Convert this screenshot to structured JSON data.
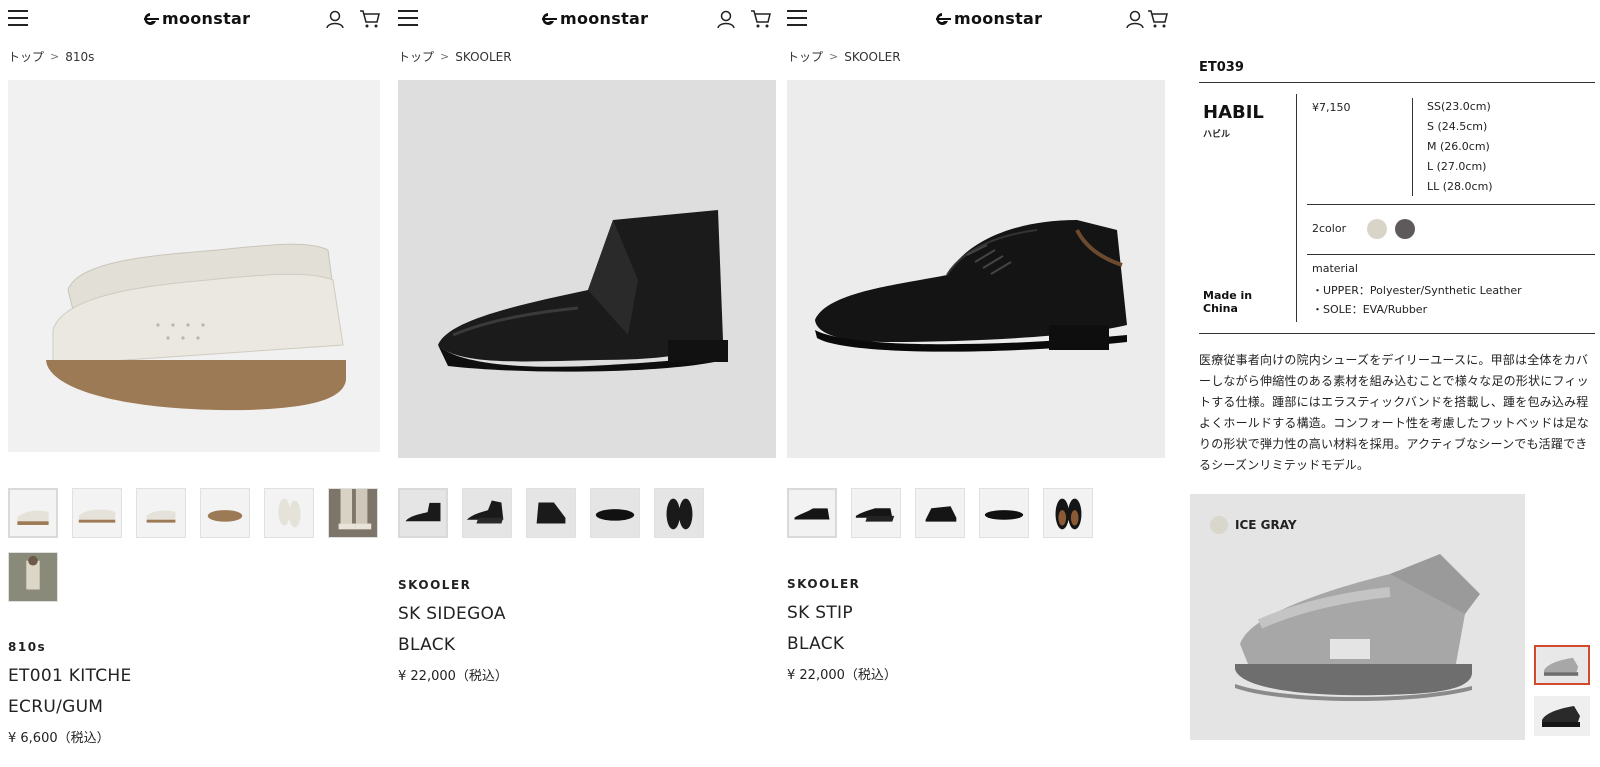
{
  "header": {
    "logo_text": "moonstar",
    "menu_icon": "hamburger-menu-icon",
    "user_icon": "user-account-icon",
    "cart_icon": "shopping-cart-icon"
  },
  "products": [
    {
      "breadcrumb": [
        "トップ",
        "810s"
      ],
      "brand": "810s",
      "name": "ET001 KITCHE",
      "color": "ECRU/GUM",
      "price": "¥ 6,600（税込）",
      "colors": {
        "upper": "#e8e5dd",
        "sole": "#9c7a55"
      }
    },
    {
      "breadcrumb": [
        "トップ",
        "SKOOLER"
      ],
      "brand": "SKOOLER",
      "name": "SK SIDEGOA",
      "color": "BLACK",
      "price": "¥ 22,000（税込）",
      "colors": {
        "upper": "#1a1a1a",
        "sole": "#111111"
      }
    },
    {
      "breadcrumb": [
        "トップ",
        "SKOOLER"
      ],
      "brand": "SKOOLER",
      "name": "SK STIP",
      "color": "BLACK",
      "price": "¥ 22,000（税込）",
      "colors": {
        "upper": "#151515",
        "sole": "#0e0e0e"
      }
    }
  ],
  "breadcrumb_separator": ">",
  "spec": {
    "sku": "ET039",
    "name": "HABIL",
    "name_kana": "ハビル",
    "made_in": "Made in China",
    "price": "¥7,150",
    "sizes": [
      "SS(23.0cm)",
      "S (24.5cm)",
      "M (26.0cm)",
      "L (27.0cm)",
      "LL (28.0cm)"
    ],
    "colors_label": "2color",
    "swatches": [
      "#d8d4c8",
      "#5e5a5c"
    ],
    "material_label": "material",
    "materials": [
      "・UPPER：Polyester/Synthetic Leather",
      "・SOLE：EVA/Rubber"
    ],
    "description": "医療従事者向けの院内シューズをデイリーユースに。甲部は全体をカバーしながら伸縮性のある素材を組み込むことで様々な足の形状にフィットする仕様。踵部にはエラスティックバンドを搭載し、踵を包み込み程よくホールドする構造。コンフォート性を考慮したフットベッドは足なりの形状で弾力性の高い材料を採用。アクティブなシーンでも活躍できるシーズンリミテッドモデル。",
    "variant_label": "ICE GRAY",
    "variant_chip_color": "#d9d6cc",
    "accent_color": "#d24a2e"
  }
}
